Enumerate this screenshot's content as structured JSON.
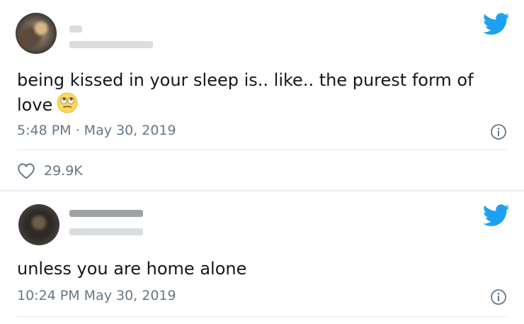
{
  "tweets": [
    {
      "text": "being kissed in your sleep is.. like.. the purest form of love",
      "timestamp": "5:48 PM · May 30, 2019",
      "likes": "29.9K",
      "emoji": "face-with-rolling-eyes",
      "author": {
        "avatar": "blurred-profile-photo",
        "name": "",
        "handle": ""
      }
    },
    {
      "text": "unless you are home alone",
      "timestamp": "10:24 PM May 30, 2019",
      "author": {
        "avatar": "blurred-profile-photo",
        "name": "",
        "handle": ""
      }
    }
  ],
  "colors": {
    "twitter_blue": "#1da1f2",
    "text": "#14171a",
    "secondary_text": "#657786",
    "divider": "#e1e8ed"
  },
  "icons": [
    "twitter-bird-icon",
    "info-icon",
    "heart-icon"
  ]
}
